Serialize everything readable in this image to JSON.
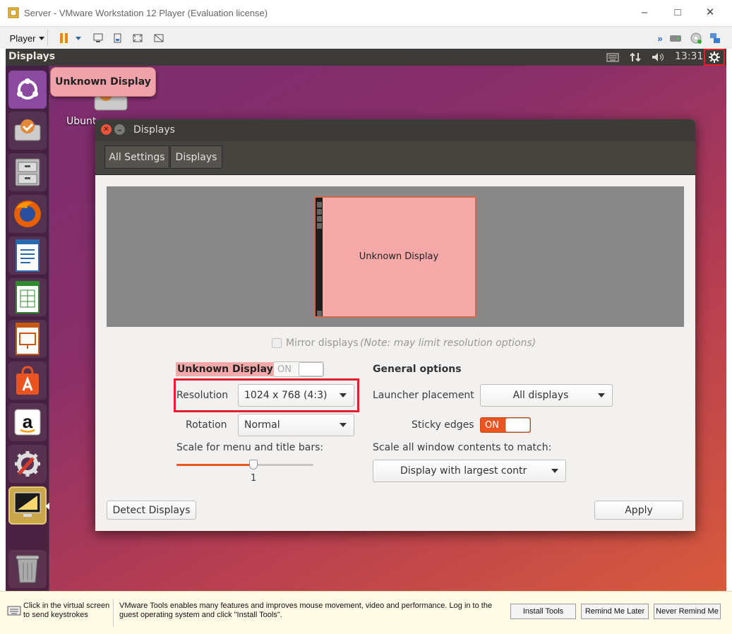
{
  "window": {
    "title": "Server - VMware Workstation 12 Player (Evaluation license)",
    "minimize": "–",
    "maximize": "□",
    "close": "✕"
  },
  "toolbar": {
    "player_label": "Player"
  },
  "panel": {
    "app_name": "Displays",
    "time": "13:31"
  },
  "tooltip": "Unknown Display",
  "desktop_icon_label": "Ubunt",
  "dialog": {
    "title": "Displays",
    "nav": [
      "All Settings",
      "Displays"
    ],
    "monitor_label": "Unknown Display",
    "mirror_label": "Mirror displays",
    "mirror_note": "(Note: may limit resolution options)",
    "mirror_checked": false,
    "display_name": "Unknown Display",
    "display_toggle": "ON",
    "resolution_label": "Resolution",
    "resolution_value": "1024 x 768 (4:3)",
    "rotation_label": "Rotation",
    "rotation_value": "Normal",
    "scale_label": "Scale for menu and title bars:",
    "scale_value": "1",
    "general_options": "General options",
    "launcher_label": "Launcher placement",
    "launcher_value": "All displays",
    "sticky_label": "Sticky edges",
    "sticky_toggle": "ON",
    "scale_all_label": "Scale all window contents to match:",
    "scale_all_value": "Display with largest contr",
    "detect_button": "Detect Displays",
    "apply_button": "Apply"
  },
  "bottom": {
    "click_hint": "Click in the virtual screen to send keystrokes",
    "message": "VMware Tools enables many features and improves mouse movement, video and performance. Log in to the guest operating system and click \"Install Tools\".",
    "install": "Install Tools",
    "remind": "Remind Me Later",
    "never": "Never Remind Me"
  },
  "colors": {
    "accent_orange": "#e95420",
    "highlight_red": "#e0202a",
    "panel_dark": "#3c3b37"
  }
}
